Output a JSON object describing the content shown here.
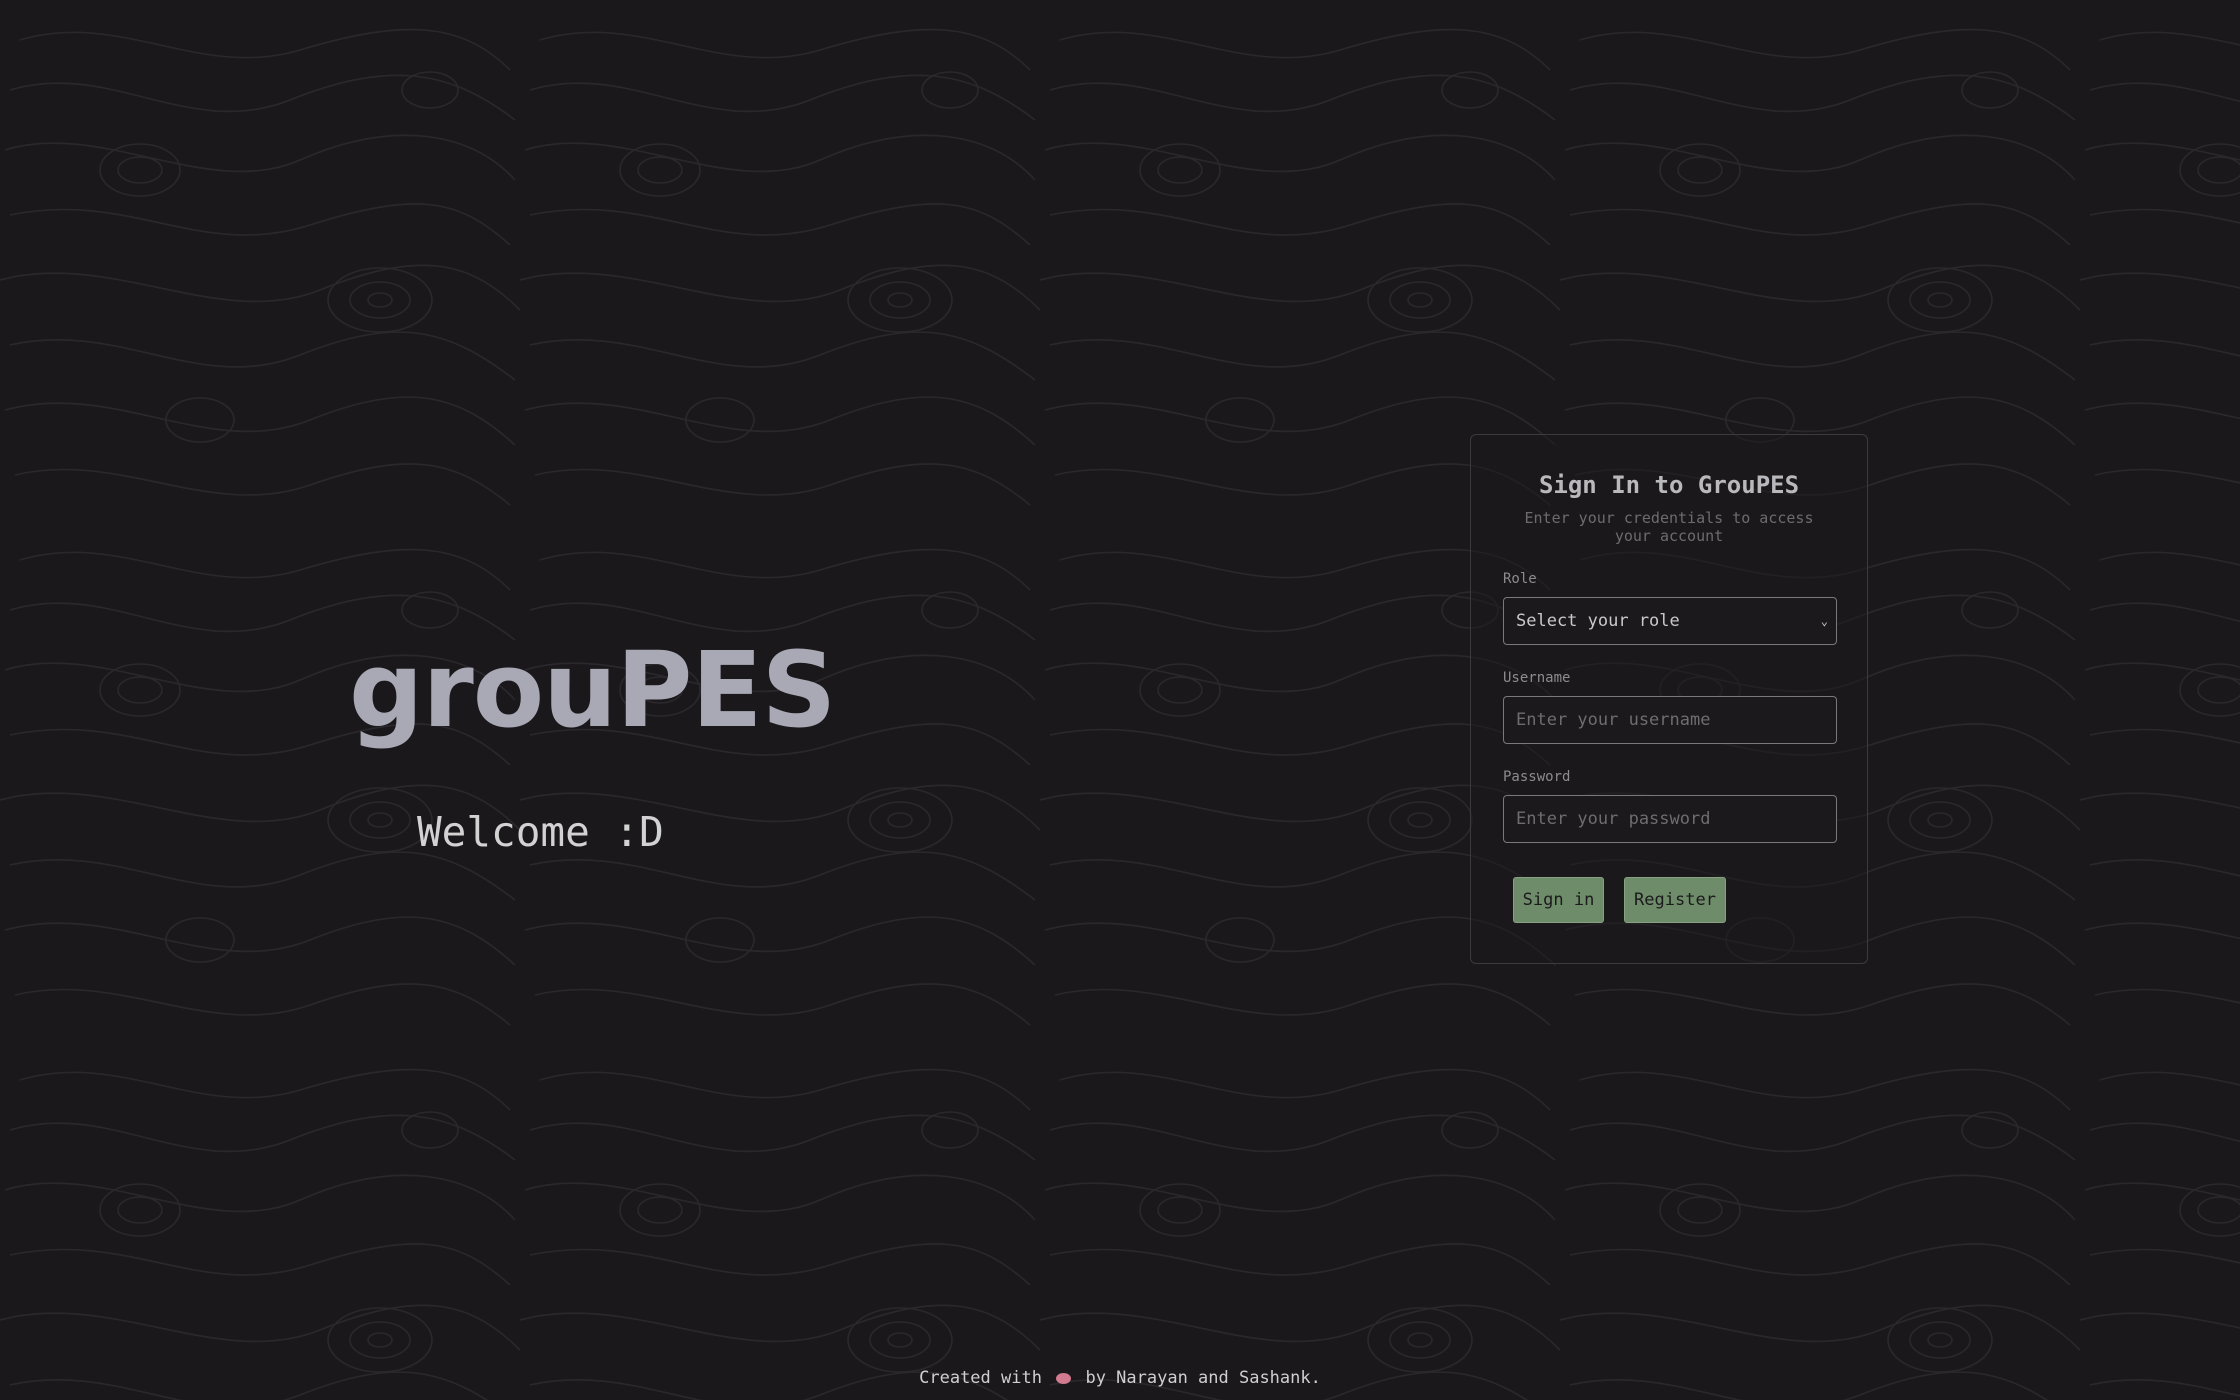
{
  "hero": {
    "title": "grouPES",
    "welcome": "Welcome :D"
  },
  "signin_card": {
    "title": "Sign In to GrouPES",
    "subtitle": "Enter your credentials to access your account",
    "role": {
      "label": "Role",
      "selected": "Select your role"
    },
    "username": {
      "label": "Username",
      "placeholder": "Enter your username"
    },
    "password": {
      "label": "Password",
      "placeholder": "Enter your password"
    },
    "buttons": {
      "signin_label": "Sign in",
      "register_label": "Register"
    }
  },
  "footer": {
    "prefix": "Created with",
    "icon": "heart-icon",
    "suffix": "by Narayan and Sashank."
  },
  "colors": {
    "background": "#1a181b",
    "title": "#a9a8b5",
    "button": "#6f8c6a",
    "heart": "#d27a8f"
  }
}
